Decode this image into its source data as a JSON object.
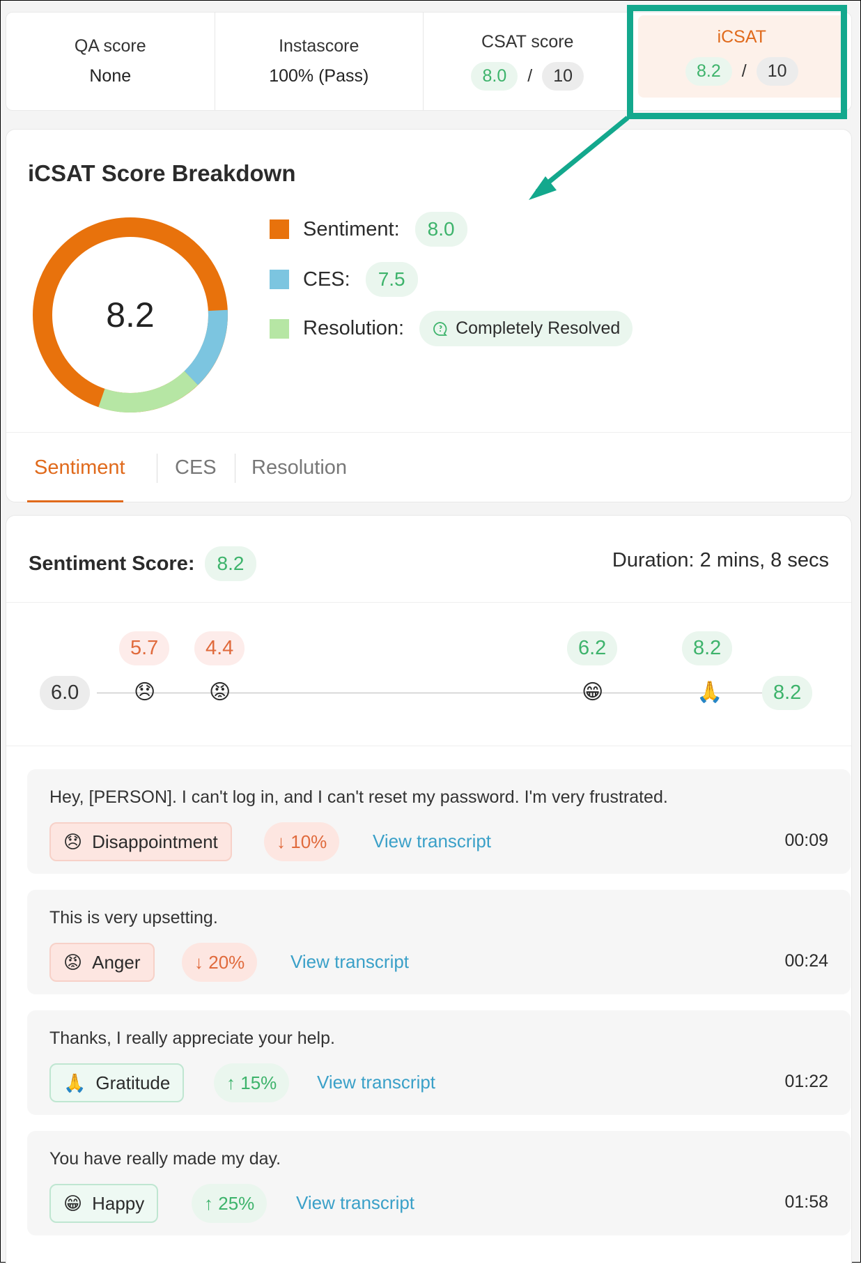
{
  "top_scores": [
    {
      "label": "QA score",
      "value": "None"
    },
    {
      "label": "Instascore",
      "value": "100% (Pass)"
    },
    {
      "label": "CSAT score",
      "score": "8.0",
      "sep": "/",
      "max": "10"
    },
    {
      "label": "iCSAT",
      "score": "8.2",
      "sep": "/",
      "max": "10"
    }
  ],
  "breakdown": {
    "title": "iCSAT Score Breakdown",
    "total": "8.2",
    "legend": [
      {
        "label": "Sentiment:",
        "value": "8.0",
        "color": "#e8720c"
      },
      {
        "label": "CES:",
        "value": "7.5",
        "color": "#7cc5e0"
      },
      {
        "label": "Resolution:",
        "value": "Completely Resolved",
        "color": "#b6e6a4"
      }
    ],
    "tabs": [
      "Sentiment",
      "CES",
      "Resolution"
    ],
    "active_tab": "Sentiment"
  },
  "sentiment": {
    "title": "Sentiment Score:",
    "score": "8.2",
    "duration": "Duration: 2 mins, 8 secs",
    "timeline": {
      "start": "6.0",
      "end": "8.2",
      "points": [
        {
          "value": "5.7",
          "emoji": "😞",
          "tone": "red"
        },
        {
          "value": "4.4",
          "emoji": "😡",
          "tone": "red"
        },
        {
          "value": "6.2",
          "emoji": "😁",
          "tone": "green"
        },
        {
          "value": "8.2",
          "emoji": "🙏",
          "tone": "green"
        }
      ]
    },
    "items": [
      {
        "text": "Hey, [PERSON]. I can't log in, and I can't reset my password. I'm very frustrated.",
        "emotion": "Disappointment",
        "emoji": "😞",
        "delta": "10%",
        "direction": "down",
        "link": "View transcript",
        "time": "00:09"
      },
      {
        "text": "This is very upsetting.",
        "emotion": "Anger",
        "emoji": "😡",
        "delta": "20%",
        "direction": "down",
        "link": "View transcript",
        "time": "00:24"
      },
      {
        "text": "Thanks, I really appreciate your help.",
        "emotion": "Gratitude",
        "emoji": "🙏",
        "delta": "15%",
        "direction": "up",
        "link": "View transcript",
        "time": "01:22"
      },
      {
        "text": "You have really made my day.",
        "emotion": "Happy",
        "emoji": "😁",
        "delta": "25%",
        "direction": "up",
        "link": "View transcript",
        "time": "01:58"
      }
    ]
  },
  "colors": {
    "accent_orange": "#e06a1c",
    "callout_teal": "#13a88d",
    "positive_green": "#3db36b",
    "negative_red": "#e06a3c",
    "link_blue": "#3aa0c8"
  }
}
